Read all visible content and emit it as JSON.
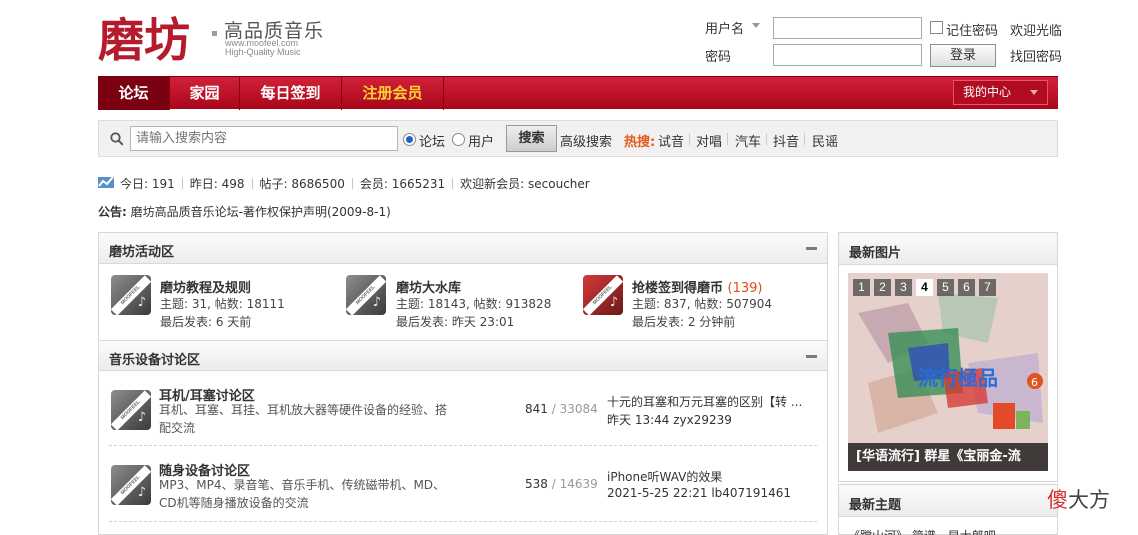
{
  "header": {
    "logo_text": "磨坊",
    "tagline": "高品质音乐",
    "site_url": "www.moofeel.com",
    "site_sub": "High-Quality Music"
  },
  "login": {
    "username_label": "用户名",
    "password_label": "密码",
    "remember_label": "记住密码",
    "login_button": "登录",
    "welcome_link": "欢迎光临",
    "recover_link": "找回密码"
  },
  "nav": {
    "items": [
      {
        "label": "论坛"
      },
      {
        "label": "家园"
      },
      {
        "label": "每日签到"
      },
      {
        "label": "注册会员"
      }
    ],
    "my_center": "我的中心"
  },
  "search": {
    "placeholder": "请输入搜索内容",
    "option_forum": "论坛",
    "option_user": "用户",
    "button": "搜索",
    "advanced": "高级搜索",
    "hot_label": "热搜:",
    "hot_terms": [
      "试音",
      "对唱",
      "汽车",
      "抖音",
      "民谣"
    ]
  },
  "stats": {
    "today": "今日: 191",
    "yesterday": "昨日: 498",
    "posts": "帖子: 8686500",
    "members": "会员: 1665231",
    "newest": "欢迎新会员: secoucher"
  },
  "notice": {
    "label": "公告:",
    "text": "磨坊高品质音乐论坛-著作权保护声明(2009-8-1)"
  },
  "section_activity": {
    "title": "磨坊活动区",
    "forums": [
      {
        "name": "磨坊教程及规则",
        "count": "",
        "stats": "主题: 31, 帖数: 18111",
        "last": "最后发表: 6 天前"
      },
      {
        "name": "磨坊大水库",
        "count": "",
        "stats": "主题: 18143, 帖数: 913828",
        "last": "最后发表: 昨天 23:01"
      },
      {
        "name": "抢楼签到得磨币",
        "count": "(139)",
        "stats": "主题: 837, 帖数: 507904",
        "last": "最后发表: 2 分钟前"
      }
    ]
  },
  "section_audio": {
    "title": "音乐设备讨论区",
    "forums": [
      {
        "name": "耳机/耳塞讨论区",
        "desc": "耳机、耳塞、耳挂、耳机放大器等硬件设备的经验、搭配交流",
        "threads": "841",
        "posts": "33084",
        "last_title": "十元的耳塞和万元耳塞的区别【转 ...",
        "last_info": "昨天 13:44 zyx29239"
      },
      {
        "name": "随身设备讨论区",
        "desc": "MP3、MP4、录音笔、音乐手机、传统磁带机、MD、CD机等随身播放设备的交流",
        "threads": "538",
        "posts": "14639",
        "last_title": "iPhone听WAV的效果",
        "last_info": "2021-5-25 22:21 lb407191461"
      }
    ]
  },
  "sidebar": {
    "latest_images_title": "最新图片",
    "slide_numbers": [
      "1",
      "2",
      "3",
      "4",
      "5",
      "6",
      "7"
    ],
    "slide_active": "4",
    "slide_caption": "[华语流行] 群星《宝丽金-流",
    "latest_topics_title": "最新主题",
    "latest_topic_first": "《蹚山河》 简谱 - 早大郎吧"
  },
  "watermark": {
    "text_1": "傻",
    "text_2": "大方"
  },
  "colors": {
    "nav_red": "#c0152b",
    "hot_orange": "#e4591c",
    "register_yellow": "#ffd233"
  },
  "icons": [
    "search-icon",
    "stats-icon",
    "forum-icon",
    "collapse-icon",
    "dropdown-caret-icon"
  ]
}
